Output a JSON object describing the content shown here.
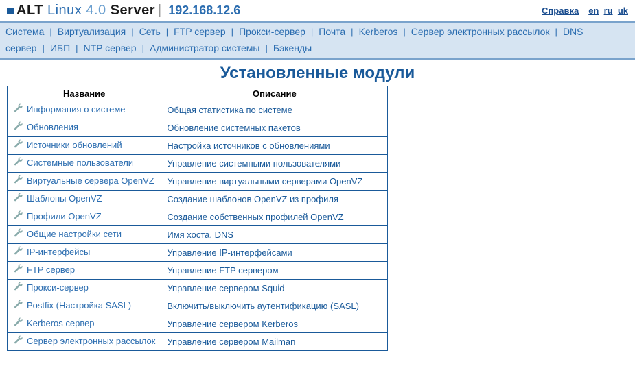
{
  "header": {
    "logo_alt": "ALT",
    "logo_linux": "Linux",
    "logo_version": "4.0",
    "logo_server": "Server",
    "ip": "192.168.12.6",
    "help": "Справка",
    "langs": [
      "en",
      "ru",
      "uk"
    ]
  },
  "nav": [
    "Система",
    "Виртуализация",
    "Сеть",
    "FTP сервер",
    "Прокси-сервер",
    "Почта",
    "Kerberos",
    "Сервер электронных рассылок",
    "DNS сервер",
    "ИБП",
    "NTP сервер",
    "Администратор системы",
    "Бэкенды"
  ],
  "page_title": "Установленные модули",
  "table": {
    "col_name": "Название",
    "col_desc": "Описание"
  },
  "modules": [
    {
      "name": "Информация о системе",
      "desc": "Общая статистика по системе"
    },
    {
      "name": "Обновления",
      "desc": "Обновление системных пакетов"
    },
    {
      "name": "Источники обновлений",
      "desc": "Настройка источников с обновлениями"
    },
    {
      "name": "Системные пользователи",
      "desc": "Управление системными пользователями"
    },
    {
      "name": "Виртуальные сервера OpenVZ",
      "desc": "Управление виртуальными серверами OpenVZ"
    },
    {
      "name": "Шаблоны OpenVZ",
      "desc": "Создание шаблонов OpenVZ из профиля"
    },
    {
      "name": "Профили OpenVZ",
      "desc": "Создание собственных профилей OpenVZ"
    },
    {
      "name": "Общие настройки сети",
      "desc": "Имя хоста, DNS"
    },
    {
      "name": "IP-интерфейсы",
      "desc": "Управление IP-интерфейсами"
    },
    {
      "name": "FTP сервер",
      "desc": "Управление FTP сервером"
    },
    {
      "name": "Прокси-сервер",
      "desc": "Управление сервером Squid"
    },
    {
      "name": "Postfix (Настройка SASL)",
      "desc": "Включить/выключить аутентификацию (SASL)"
    },
    {
      "name": "Kerberos сервер",
      "desc": "Управление сервером Kerberos"
    },
    {
      "name": "Сервер электронных рассылок",
      "desc": "Управление сервером Mailman"
    }
  ]
}
